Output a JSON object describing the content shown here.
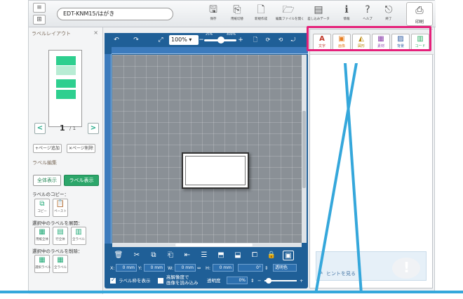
{
  "window": {
    "title": "EDT-KNM15/はがき"
  },
  "toolbar": {
    "buttons": [
      {
        "label": "保存",
        "icon": "save-icon",
        "glyph": "🖫"
      },
      {
        "label": "用紙切替",
        "icon": "page-switch-icon",
        "glyph": "⎘"
      },
      {
        "label": "新規作成",
        "icon": "new-file-icon",
        "glyph": "🗋"
      },
      {
        "label": "編集ファイルを開く",
        "icon": "open-file-icon",
        "glyph": "🗁"
      },
      {
        "label": "差し込みデータ",
        "icon": "merge-data-icon",
        "glyph": "▤"
      },
      {
        "label": "情報",
        "icon": "info-icon",
        "glyph": "ℹ"
      },
      {
        "label": "ヘルプ",
        "icon": "help-icon",
        "glyph": "?"
      },
      {
        "label": "終了",
        "icon": "exit-icon",
        "glyph": "⎋"
      }
    ],
    "print_label": "印刷"
  },
  "left_panel": {
    "title": "ラベルレイアウト",
    "close": "×",
    "page_current": "1",
    "page_total": "/ 1",
    "prev": "<",
    "next": ">",
    "add_page": "+ページ追加",
    "delete_page": "✕ページ削除",
    "label_edit": "ラベル編集",
    "show_all": "全体表示",
    "show_label": "ラベル表示",
    "copy_section": "ラベルのコピー：",
    "copy_btn": "コピー",
    "paste_btn": "ペースト",
    "expand_section": "選択中のラベルを展開：",
    "expand_all": "用紙全体",
    "expand_row": "行全体",
    "expand_labels": "全ラベル",
    "delete_section": "選択中のラベルを削除：",
    "delete_selected": "選択ラベル",
    "delete_all": "全ラベル"
  },
  "canvas": {
    "zoom": "100%",
    "zoom_min": "25%",
    "zoom_max": "400%",
    "fit_icon": "fit-screen-icon",
    "coords": {
      "x_label": "X:",
      "x_val": "0 mm",
      "y_label": "Y:",
      "y_val": "0 mm",
      "w_label": "W:",
      "w_val": "0 mm",
      "h_label": "H:",
      "h_val": "0 mm",
      "angle": "0°",
      "transparent_label": "透明色"
    },
    "show_frame": "ラベル枠を表示",
    "hires_line1": "高解像度で",
    "hires_line2": "画像を読み込み",
    "opacity_label": "透明度",
    "opacity_val": "0%"
  },
  "right_panel": {
    "tabs": [
      {
        "label": "文字",
        "glyph": "A",
        "color": "#c0392b"
      },
      {
        "label": "画像",
        "glyph": "▣",
        "color": "#e67e22"
      },
      {
        "label": "図形",
        "glyph": "◭",
        "color": "#b8860b"
      },
      {
        "label": "素材",
        "glyph": "▦",
        "color": "#8e44ad"
      },
      {
        "label": "背景",
        "glyph": "▨",
        "color": "#2c5aa0"
      },
      {
        "label": "コード",
        "glyph": "▥",
        "color": "#27ae60"
      }
    ],
    "hint": "ヒントを見る"
  },
  "colors": {
    "accent": "#1f5f97",
    "highlight": "#e5207a",
    "pointer": "#35a7db",
    "green": "#2ca66a"
  }
}
